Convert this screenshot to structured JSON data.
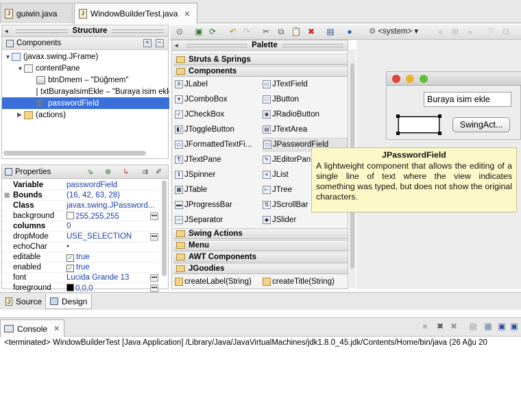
{
  "editor_tabs": [
    {
      "label": "guiwin.java",
      "active": false
    },
    {
      "label": "WindowBuilderTest.java",
      "active": true,
      "close": "✕"
    }
  ],
  "structure": {
    "title": "Structure",
    "components_label": "Components",
    "tree": [
      {
        "label": "(javax.swing.JFrame)",
        "level": 0
      },
      {
        "label": "contentPane",
        "level": 1
      },
      {
        "label": "btnDmem – \"Düğmem\"",
        "level": 2
      },
      {
        "label": "txtBurayaIsimEkle – \"Buraya isim ekle\"",
        "level": 2
      },
      {
        "label": "passwordField",
        "level": 2,
        "selected": true
      },
      {
        "label": "(actions)",
        "level": 1
      }
    ]
  },
  "properties": {
    "title": "Properties",
    "rows": [
      {
        "key": "Variable",
        "value": "passwordField",
        "bold": true
      },
      {
        "key": "Bounds",
        "value": "(16, 42, 63, 28)",
        "bold": true,
        "expand": "⊞"
      },
      {
        "key": "Class",
        "value": "javax.swing.JPassword...",
        "bold": true
      },
      {
        "key": "background",
        "value": "255,255,255"
      },
      {
        "key": "columns",
        "value": "0",
        "bold": true
      },
      {
        "key": "dropMode",
        "value": "USE_SELECTION"
      },
      {
        "key": "echoChar",
        "value": "•"
      },
      {
        "key": "editable",
        "value": "true",
        "check": "✓"
      },
      {
        "key": "enabled",
        "value": "true",
        "check": "✓"
      },
      {
        "key": "font",
        "value": "Lucida Grande 13"
      },
      {
        "key": "foreground",
        "value": "0,0,0"
      }
    ]
  },
  "toolbar": {
    "lookandfeel": "<system>"
  },
  "palette": {
    "title": "Palette",
    "categories": {
      "struts": "Struts & Springs",
      "components": "Components",
      "swing_actions": "Swing Actions",
      "menu": "Menu",
      "awt": "AWT Components",
      "jgoodies": "JGoodies"
    },
    "left_items": [
      "JLabel",
      "JComboBox",
      "JCheckBox",
      "JToggleButton",
      "JFormattedTextFi...",
      "JTextPane",
      "JSpinner",
      "JTable",
      "JProgressBar",
      "JSeparator"
    ],
    "right_items": [
      "JTextField",
      "JButton",
      "JRadioButton",
      "JTextArea",
      "JPasswordField",
      "JEditorPan",
      "JList",
      "JTree",
      "JScrollBar",
      "JSlider"
    ],
    "jgoodies_items": [
      "createLabel(String)",
      "createTitle(String)"
    ]
  },
  "tooltip": {
    "title": "JPasswordField",
    "text": "A lightweight component that allows the editing of a single line of text where the view indicates something was typed, but does not show the original characters."
  },
  "design_preview": {
    "text_field_value": "Buraya isim ekle",
    "button_label": "SwingAct..."
  },
  "bottom_tabs": {
    "source": "Source",
    "design": "Design"
  },
  "console": {
    "tab_label": "Console",
    "close": "✕",
    "output": "<terminated> WindowBuilderTest [Java Application] /Library/Java/JavaVirtualMachines/jdk1.8.0_45.jdk/Contents/Home/bin/java (26 Ağu 20"
  }
}
